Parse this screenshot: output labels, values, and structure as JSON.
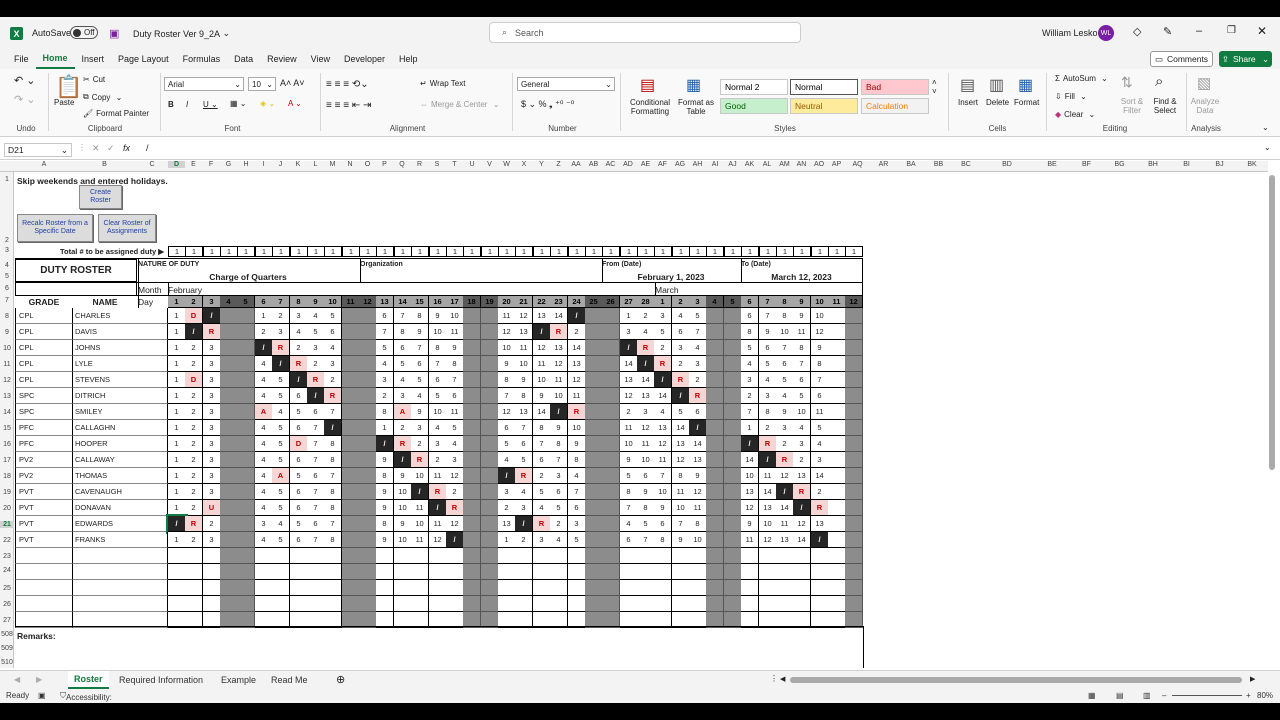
{
  "titlebar": {
    "autosave": "AutoSave",
    "toggle": "Off",
    "filename": "Duty Roster Ver 9_2A",
    "search_placeholder": "Search",
    "user": "William Lesko",
    "initials": "WL"
  },
  "menu": [
    "File",
    "Home",
    "Insert",
    "Page Layout",
    "Formulas",
    "Data",
    "Review",
    "View",
    "Developer",
    "Help"
  ],
  "active_menu": "Home",
  "header_buttons": {
    "comments": "Comments",
    "share": "Share"
  },
  "ribbon": {
    "undo_label": "Undo",
    "clipboard_label": "Clipboard",
    "paste": "Paste",
    "cut": "Cut",
    "copy": "Copy",
    "format_painter": "Format Painter",
    "font_label": "Font",
    "font_name": "Arial",
    "font_size": "10",
    "alignment_label": "Alignment",
    "wrap_text": "Wrap Text",
    "merge_center": "Merge & Center",
    "number_label": "Number",
    "number_format": "General",
    "styles_label": "Styles",
    "conditional_formatting": "Conditional Formatting",
    "format_as_table": "Format as Table",
    "styles": [
      {
        "name": "Normal 2",
        "bg": "#ffffff",
        "fg": "#000000"
      },
      {
        "name": "Normal",
        "bg": "#ffffff",
        "fg": "#000000"
      },
      {
        "name": "Bad",
        "bg": "#ffc7ce",
        "fg": "#9c0006"
      },
      {
        "name": "Good",
        "bg": "#c6efce",
        "fg": "#006100"
      },
      {
        "name": "Neutral",
        "bg": "#ffeb9c",
        "fg": "#9c5700"
      },
      {
        "name": "Calculation",
        "bg": "#f2f2f2",
        "fg": "#fa7d00"
      }
    ],
    "cells_label": "Cells",
    "insert": "Insert",
    "delete": "Delete",
    "format": "Format",
    "editing_label": "Editing",
    "autosum": "AutoSum",
    "fill": "Fill",
    "clear": "Clear",
    "sort_filter": "Sort & Filter",
    "find_select": "Find & Select",
    "analysis_label": "Analysis",
    "analyze_data": "Analyze Data"
  },
  "formula_bar": {
    "name_box": "D21",
    "formula": "/",
    "fx": "fx"
  },
  "columns": [
    "A",
    "B",
    "C",
    "D",
    "E",
    "F",
    "G",
    "H",
    "I",
    "J",
    "K",
    "L",
    "M",
    "N",
    "O",
    "P",
    "Q",
    "R",
    "S",
    "T",
    "U",
    "V",
    "W",
    "X",
    "Y",
    "Z",
    "AA",
    "AB",
    "AC",
    "AD",
    "AE",
    "AF",
    "AG",
    "AH",
    "AI",
    "AJ",
    "AK",
    "AL",
    "AM",
    "AN",
    "AO",
    "AP",
    "AQ",
    "AR",
    "BA",
    "BB",
    "BC",
    "BD",
    "BE",
    "BF",
    "BG",
    "BH",
    "BI",
    "BJ",
    "BK",
    "BL"
  ],
  "row_numbers": [
    "1",
    "2",
    "3",
    "4",
    "5",
    "6",
    "7",
    "8",
    "9",
    "10",
    "11",
    "12",
    "13",
    "14",
    "15",
    "16",
    "17",
    "18",
    "19",
    "20",
    "21",
    "22",
    "23",
    "24",
    "25",
    "26",
    "27",
    "508",
    "509",
    "510"
  ],
  "sheet": {
    "instruction": "Skip weekends and entered holidays.",
    "buttons": {
      "create": "Create Roster",
      "recalc": "Recalc Roster from a Specific Date",
      "clear": "Clear Roster of Assignments"
    },
    "total_label": "Total # to be assigned duty ▶",
    "title": "DUTY ROSTER",
    "nature_label": "NATURE OF DUTY",
    "nature_value": "Charge of Quarters",
    "org_label": "Organization",
    "from_label": "From (Date)",
    "from_value": "February 1, 2023",
    "to_label": "To (Date)",
    "to_value": "March 12, 2023",
    "month_label": "Month",
    "day_label": "Day",
    "grade_label": "GRADE",
    "name_label": "NAME",
    "month1": "February",
    "month2": "March",
    "remarks": "Remarks:",
    "days": [
      "1",
      "2",
      "3",
      "4",
      "5",
      "6",
      "7",
      "8",
      "9",
      "10",
      "11",
      "12",
      "13",
      "14",
      "15",
      "16",
      "17",
      "18",
      "19",
      "20",
      "21",
      "22",
      "23",
      "24",
      "25",
      "26",
      "27",
      "28",
      "1",
      "2",
      "3",
      "4",
      "5",
      "6",
      "7",
      "8",
      "9",
      "10",
      "11",
      "12"
    ],
    "weekend_cols": [
      3,
      4,
      10,
      11,
      17,
      18,
      24,
      25,
      31,
      32,
      39
    ],
    "soldiers": [
      {
        "grade": "CPL",
        "name": "CHARLES",
        "cells": [
          "1",
          "D",
          "/",
          "",
          "",
          "1",
          "2",
          "3",
          "4",
          "5",
          "",
          "",
          "6",
          "7",
          "8",
          "9",
          "10",
          "",
          "",
          "11",
          "12",
          "13",
          "14",
          "/",
          "",
          "",
          "1",
          "2",
          "3",
          "4",
          "5",
          "",
          "",
          "6",
          "7",
          "8",
          "9",
          "10",
          "",
          ""
        ]
      },
      {
        "grade": "CPL",
        "name": "DAVIS",
        "cells": [
          "1",
          "/",
          "R",
          "",
          "",
          "2",
          "3",
          "4",
          "5",
          "6",
          "",
          "",
          "7",
          "8",
          "9",
          "10",
          "11",
          "",
          "",
          "12",
          "13",
          "/",
          "R",
          "2",
          "",
          "",
          "3",
          "4",
          "5",
          "6",
          "7",
          "",
          "",
          "8",
          "9",
          "10",
          "11",
          "12",
          "",
          ""
        ]
      },
      {
        "grade": "CPL",
        "name": "JOHNS",
        "cells": [
          "1",
          "2",
          "3",
          "",
          "",
          "/",
          "R",
          "2",
          "3",
          "4",
          "",
          "",
          "5",
          "6",
          "7",
          "8",
          "9",
          "",
          "",
          "10",
          "11",
          "12",
          "13",
          "14",
          "",
          "",
          "/",
          "R",
          "2",
          "3",
          "4",
          "",
          "",
          "5",
          "6",
          "7",
          "8",
          "9",
          "",
          ""
        ]
      },
      {
        "grade": "CPL",
        "name": "LYLE",
        "cells": [
          "1",
          "2",
          "3",
          "",
          "",
          "4",
          "/",
          "R",
          "2",
          "3",
          "",
          "",
          "4",
          "5",
          "6",
          "7",
          "8",
          "",
          "",
          "9",
          "10",
          "11",
          "12",
          "13",
          "",
          "",
          "14",
          "/",
          "R",
          "2",
          "3",
          "",
          "",
          "4",
          "5",
          "6",
          "7",
          "8",
          "",
          ""
        ]
      },
      {
        "grade": "CPL",
        "name": "STEVENS",
        "cells": [
          "1",
          "D",
          "3",
          "",
          "",
          "4",
          "5",
          "/",
          "R",
          "2",
          "",
          "",
          "3",
          "4",
          "5",
          "6",
          "7",
          "",
          "",
          "8",
          "9",
          "10",
          "11",
          "12",
          "",
          "",
          "13",
          "14",
          "/",
          "R",
          "2",
          "",
          "",
          "3",
          "4",
          "5",
          "6",
          "7",
          "",
          ""
        ]
      },
      {
        "grade": "SPC",
        "name": "DITRICH",
        "cells": [
          "1",
          "2",
          "3",
          "",
          "",
          "4",
          "5",
          "6",
          "/",
          "R",
          "",
          "",
          "2",
          "3",
          "4",
          "5",
          "6",
          "",
          "",
          "7",
          "8",
          "9",
          "10",
          "11",
          "",
          "",
          "12",
          "13",
          "14",
          "/",
          "R",
          "",
          "",
          "2",
          "3",
          "4",
          "5",
          "6",
          "",
          ""
        ]
      },
      {
        "grade": "SPC",
        "name": "SMILEY",
        "cells": [
          "1",
          "2",
          "3",
          "",
          "",
          "A",
          "4",
          "5",
          "6",
          "7",
          "",
          "",
          "8",
          "A",
          "9",
          "10",
          "11",
          "",
          "",
          "12",
          "13",
          "14",
          "/",
          "R",
          "",
          "",
          "2",
          "3",
          "4",
          "5",
          "6",
          "",
          "",
          "7",
          "8",
          "9",
          "10",
          "11",
          "",
          ""
        ]
      },
      {
        "grade": "PFC",
        "name": "CALLAGHN",
        "cells": [
          "1",
          "2",
          "3",
          "",
          "",
          "4",
          "5",
          "6",
          "7",
          "/",
          "",
          "",
          "1",
          "2",
          "3",
          "4",
          "5",
          "",
          "",
          "6",
          "7",
          "8",
          "9",
          "10",
          "",
          "",
          "11",
          "12",
          "13",
          "14",
          "/",
          "",
          "",
          "1",
          "2",
          "3",
          "4",
          "5",
          "",
          ""
        ]
      },
      {
        "grade": "PFC",
        "name": "HOOPER",
        "cells": [
          "1",
          "2",
          "3",
          "",
          "",
          "4",
          "5",
          "D",
          "7",
          "8",
          "",
          "",
          "/",
          "R",
          "2",
          "3",
          "4",
          "",
          "",
          "5",
          "6",
          "7",
          "8",
          "9",
          "",
          "",
          "10",
          "11",
          "12",
          "13",
          "14",
          "",
          "",
          "/",
          "R",
          "2",
          "3",
          "4",
          "",
          ""
        ]
      },
      {
        "grade": "PV2",
        "name": "CALLAWAY",
        "cells": [
          "1",
          "2",
          "3",
          "",
          "",
          "4",
          "5",
          "6",
          "7",
          "8",
          "",
          "",
          "9",
          "/",
          "R",
          "2",
          "3",
          "",
          "",
          "4",
          "5",
          "6",
          "7",
          "8",
          "",
          "",
          "9",
          "10",
          "11",
          "12",
          "13",
          "",
          "",
          "14",
          "/",
          "R",
          "2",
          "3",
          "",
          ""
        ]
      },
      {
        "grade": "PV2",
        "name": "THOMAS",
        "cells": [
          "1",
          "2",
          "3",
          "",
          "",
          "4",
          "A",
          "5",
          "6",
          "7",
          "",
          "",
          "8",
          "9",
          "10",
          "11",
          "12",
          "",
          "",
          "/",
          "R",
          "2",
          "3",
          "4",
          "",
          "",
          "5",
          "6",
          "7",
          "8",
          "9",
          "",
          "",
          "10",
          "11",
          "12",
          "13",
          "14",
          "",
          ""
        ]
      },
      {
        "grade": "PVT",
        "name": "CAVENAUGH",
        "cells": [
          "1",
          "2",
          "3",
          "",
          "",
          "4",
          "5",
          "6",
          "7",
          "8",
          "",
          "",
          "9",
          "10",
          "/",
          "R",
          "2",
          "",
          "",
          "3",
          "4",
          "5",
          "6",
          "7",
          "",
          "",
          "8",
          "9",
          "10",
          "11",
          "12",
          "",
          "",
          "13",
          "14",
          "/",
          "R",
          "2",
          "",
          ""
        ]
      },
      {
        "grade": "PVT",
        "name": "DONAVAN",
        "cells": [
          "1",
          "2",
          "U",
          "",
          "",
          "4",
          "5",
          "6",
          "7",
          "8",
          "",
          "",
          "9",
          "10",
          "11",
          "/",
          "R",
          "",
          "",
          "2",
          "3",
          "4",
          "5",
          "6",
          "",
          "",
          "7",
          "8",
          "9",
          "10",
          "11",
          "",
          "",
          "12",
          "13",
          "14",
          "/",
          "R",
          "",
          ""
        ]
      },
      {
        "grade": "PVT",
        "name": "EDWARDS",
        "cells": [
          "/",
          "R",
          "2",
          "",
          "",
          "3",
          "4",
          "5",
          "6",
          "7",
          "",
          "",
          "8",
          "9",
          "10",
          "11",
          "12",
          "",
          "",
          "13",
          "/",
          "R",
          "2",
          "3",
          "",
          "",
          "4",
          "5",
          "6",
          "7",
          "8",
          "",
          "",
          "9",
          "10",
          "11",
          "12",
          "13",
          "",
          ""
        ]
      },
      {
        "grade": "PVT",
        "name": "FRANKS",
        "cells": [
          "1",
          "2",
          "3",
          "",
          "",
          "4",
          "5",
          "6",
          "7",
          "8",
          "",
          "",
          "9",
          "10",
          "11",
          "12",
          "/",
          "",
          "",
          "1",
          "2",
          "3",
          "4",
          "5",
          "",
          "",
          "6",
          "7",
          "8",
          "9",
          "10",
          "",
          "",
          "11",
          "12",
          "13",
          "14",
          "/",
          "",
          ""
        ]
      }
    ]
  },
  "sheet_tabs": [
    "Roster",
    "Required Information",
    "Example",
    "Read Me"
  ],
  "active_tab": "Roster",
  "status": {
    "ready": "Ready",
    "accessibility": "Accessibility: Investigate",
    "zoom": "80%"
  }
}
